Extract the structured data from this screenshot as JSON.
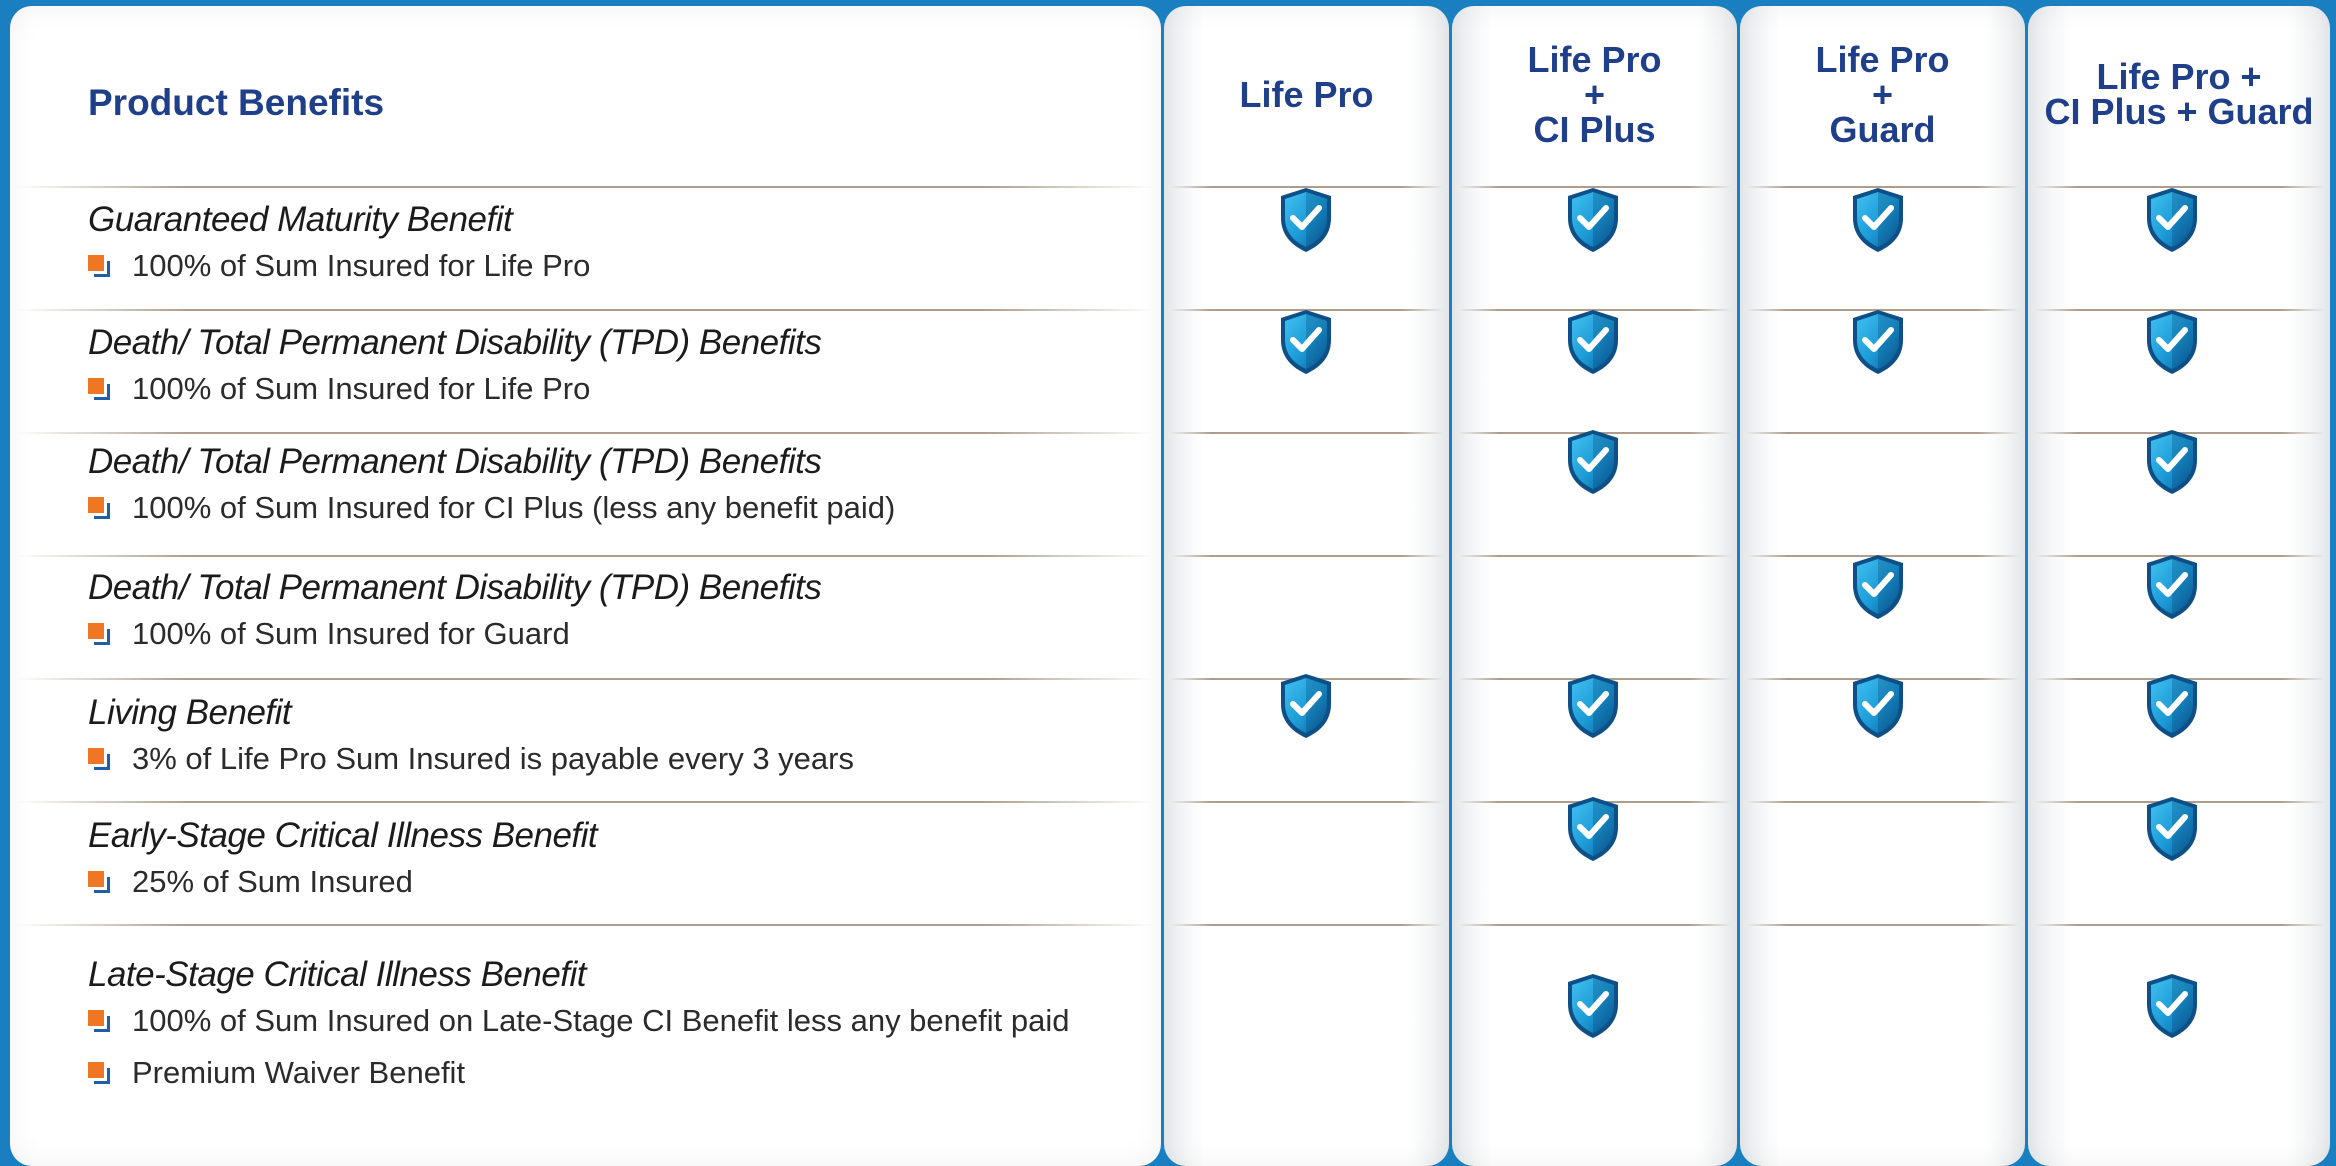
{
  "header": {
    "title": "Product Benefits",
    "columns": [
      "Life Pro",
      "Life Pro\n+\nCI Plus",
      "Life Pro\n+\nGuard",
      "Life Pro +\nCI Plus + Guard"
    ]
  },
  "rows": [
    {
      "title": "Guaranteed Maturity Benefit",
      "bullets": [
        "100% of Sum Insured for Life Pro"
      ],
      "checks": [
        true,
        true,
        true,
        true
      ]
    },
    {
      "title": "Death/ Total Permanent Disability (TPD) Benefits",
      "bullets": [
        "100% of Sum Insured for Life Pro"
      ],
      "checks": [
        true,
        true,
        true,
        true
      ]
    },
    {
      "title": "Death/ Total Permanent Disability (TPD) Benefits",
      "bullets": [
        "100% of Sum Insured for CI Plus (less any benefit paid)"
      ],
      "checks": [
        false,
        true,
        false,
        true
      ]
    },
    {
      "title": "Death/ Total Permanent Disability (TPD) Benefits",
      "bullets": [
        "100% of Sum Insured for Guard"
      ],
      "checks": [
        false,
        false,
        true,
        true
      ]
    },
    {
      "title": "Living Benefit",
      "bullets": [
        "3% of Life Pro Sum Insured is payable every 3 years"
      ],
      "checks": [
        true,
        true,
        true,
        true
      ]
    },
    {
      "title": "Early-Stage Critical Illness Benefit",
      "bullets": [
        "25% of Sum Insured"
      ],
      "checks": [
        false,
        true,
        false,
        true
      ]
    },
    {
      "title": "Late-Stage Critical Illness Benefit",
      "bullets": [
        "100% of Sum Insured on Late-Stage CI Benefit less any benefit paid",
        "Premium Waiver Benefit"
      ],
      "checks": [
        false,
        true,
        false,
        true
      ]
    }
  ],
  "icons": {
    "check": "shield-check-icon",
    "bullet": "square-bullet-icon"
  },
  "colors": {
    "background": "#1a7fc1",
    "heading": "#1f3f8a",
    "bullet": "#ef7622",
    "shield": "#1c9ad6"
  }
}
